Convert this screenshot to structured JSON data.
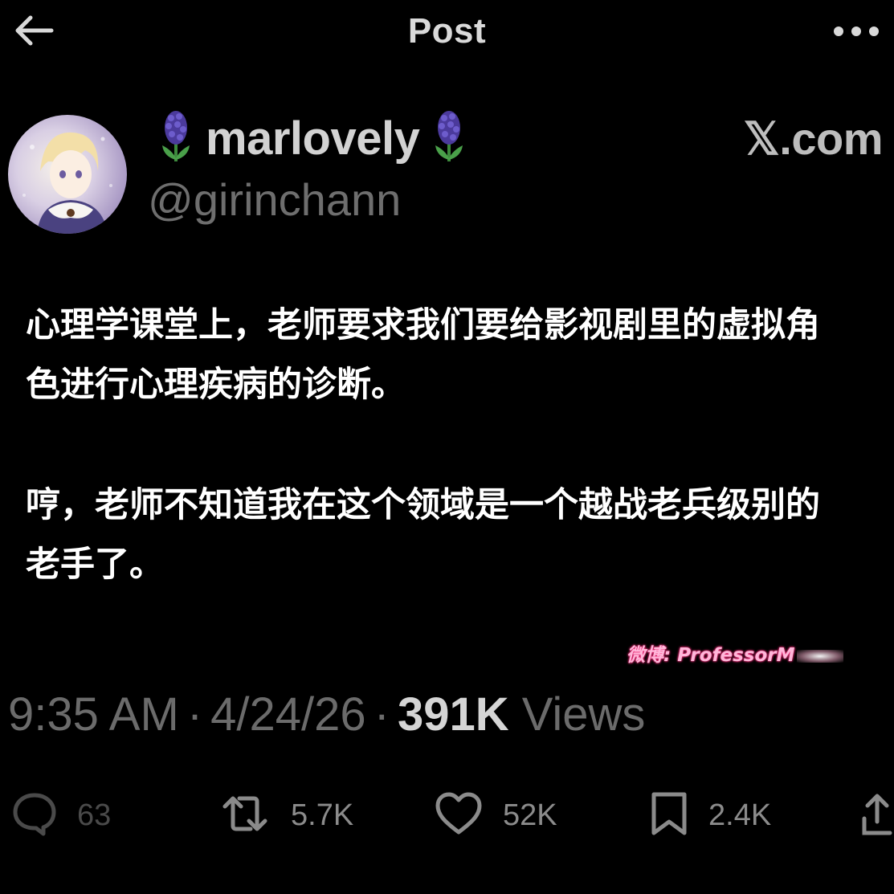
{
  "header": {
    "title": "Post",
    "back_icon": "arrow-left-icon",
    "more_icon": "more-horizontal-icon"
  },
  "author": {
    "display_name": "marlovely",
    "decoration_emoji_icon": "hyacinth-flower-icon",
    "handle": "@girinchann",
    "source": "𝕏.com"
  },
  "post": {
    "paragraphs": [
      "心理学课堂上，老师要求我们要给影视剧里的虚拟角色进行心理疾病的诊断。",
      "哼，老师不知道我在这个领域是一个越战老兵级别的老手了。"
    ]
  },
  "watermark": {
    "text": "微博: ProfessorM"
  },
  "meta": {
    "time": "9:35 AM",
    "separator": "·",
    "date": "4/24/26",
    "views_count": "391K",
    "views_label": "Views"
  },
  "actions": {
    "reply": {
      "icon": "reply-bubble-icon",
      "count": "63"
    },
    "repost": {
      "icon": "repost-arrows-icon",
      "count": "5.7K"
    },
    "like": {
      "icon": "heart-icon",
      "count": "52K"
    },
    "bookmark": {
      "icon": "bookmark-icon",
      "count": "2.4K"
    },
    "share": {
      "icon": "share-upload-icon"
    }
  },
  "colors": {
    "background": "#000000",
    "text_primary": "#ffffff",
    "text_muted": "#6b6b6b",
    "watermark": "#ff2e7e"
  }
}
